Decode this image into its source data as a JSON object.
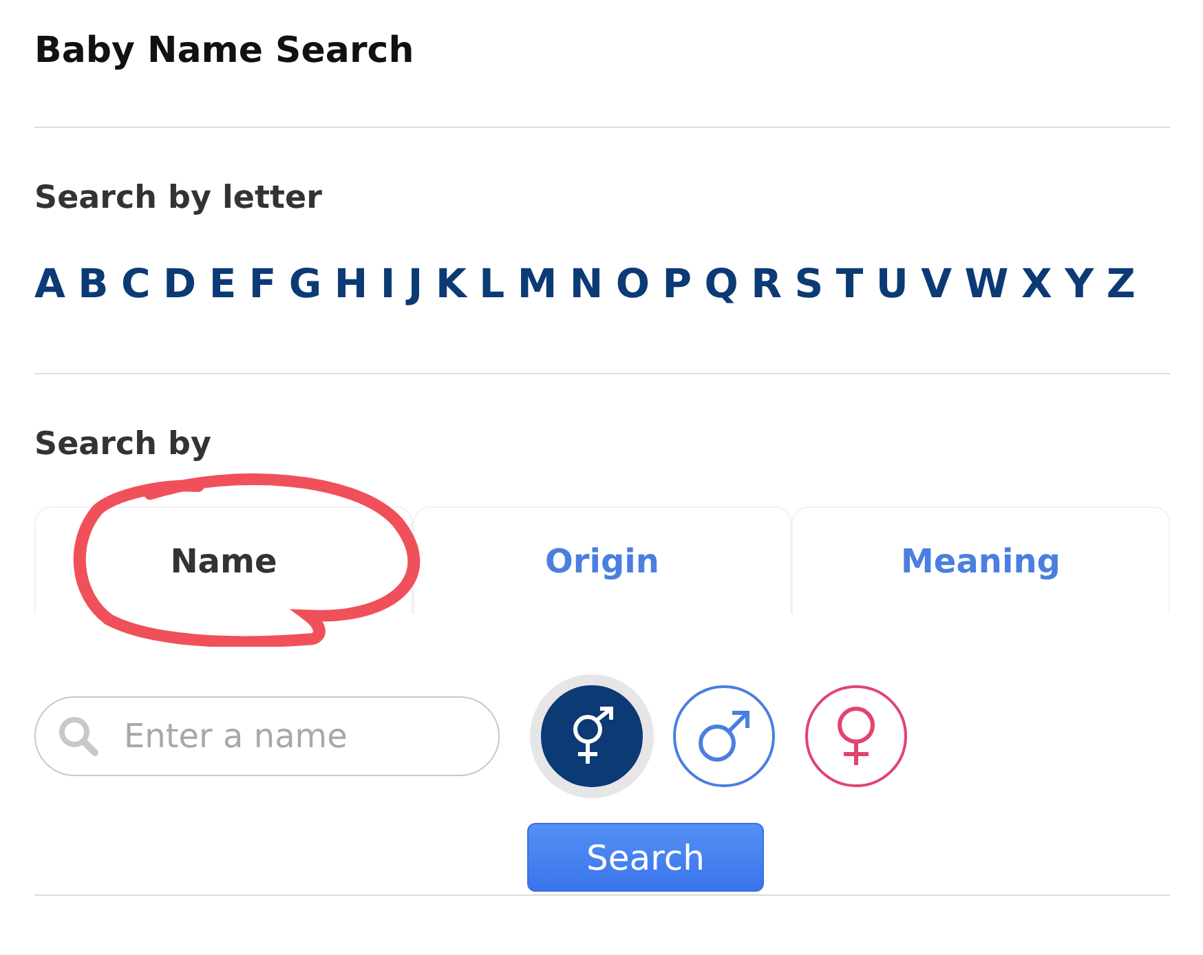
{
  "title": "Baby Name Search",
  "letter_section": {
    "heading": "Search by letter",
    "letters": [
      "A",
      "B",
      "C",
      "D",
      "E",
      "F",
      "G",
      "H",
      "I",
      "J",
      "K",
      "L",
      "M",
      "N",
      "O",
      "P",
      "Q",
      "R",
      "S",
      "T",
      "U",
      "V",
      "W",
      "X",
      "Y",
      "Z"
    ]
  },
  "search_section": {
    "heading": "Search by",
    "tabs": [
      {
        "label": "Name",
        "selected": true
      },
      {
        "label": "Origin",
        "selected": false
      },
      {
        "label": "Meaning",
        "selected": false
      }
    ],
    "search": {
      "placeholder": "Enter a name"
    },
    "genders": [
      {
        "kind": "both",
        "selected": true,
        "color": "#0b3a75"
      },
      {
        "kind": "male",
        "selected": false,
        "color": "#4a7fe0"
      },
      {
        "kind": "female",
        "selected": false,
        "color": "#e0456e"
      }
    ],
    "button": "Search"
  },
  "annotation": {
    "kind": "circle",
    "color": "#f0505a"
  }
}
